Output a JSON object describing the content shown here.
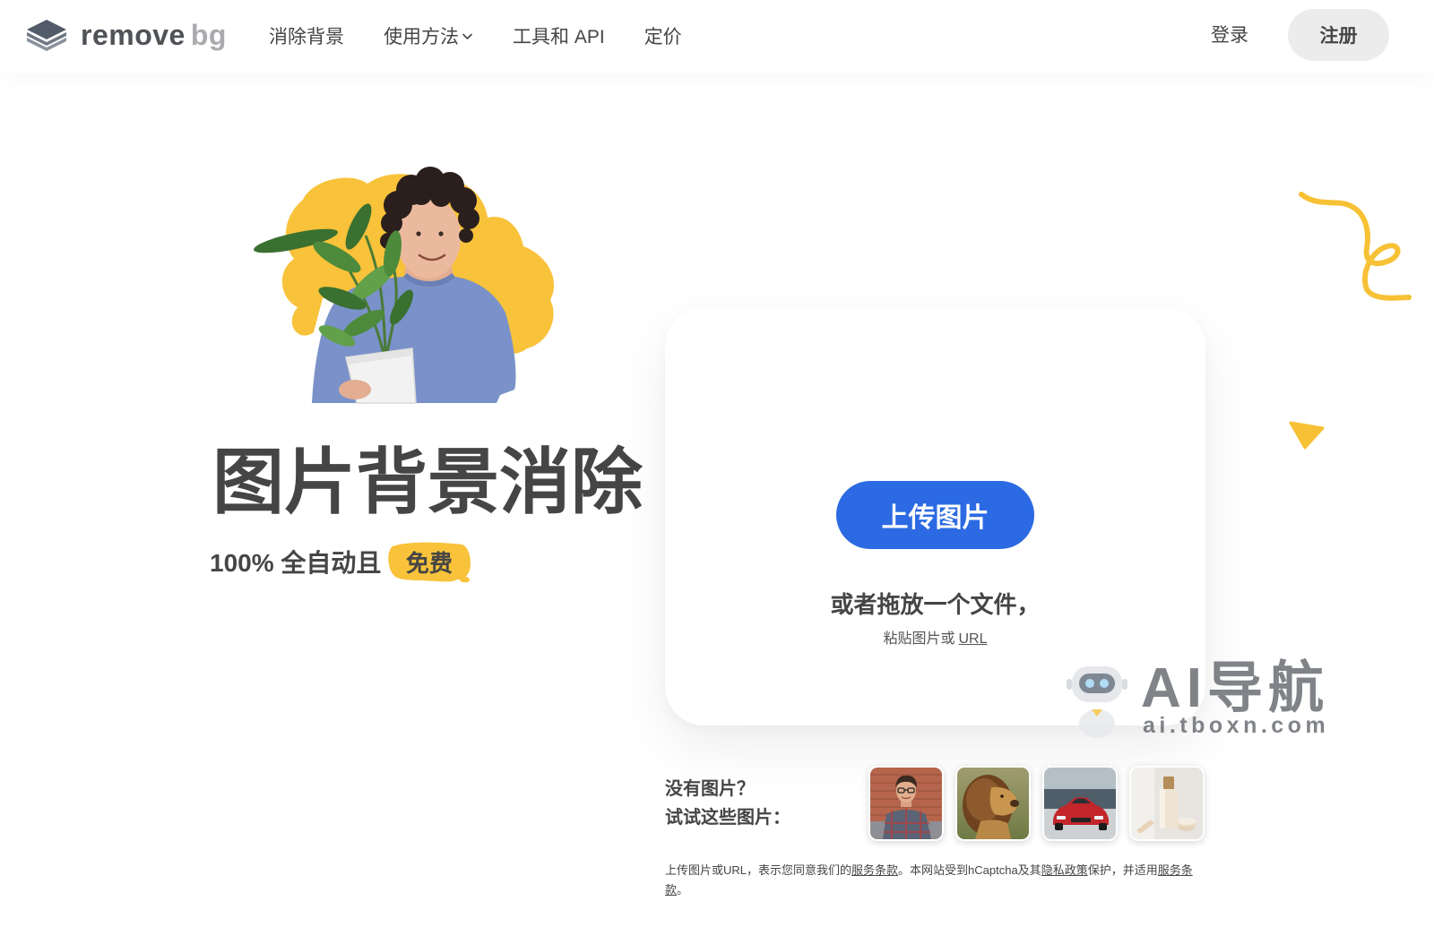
{
  "header": {
    "logo": {
      "word1": "remove",
      "word2": "bg"
    },
    "nav": [
      {
        "label": "消除背景"
      },
      {
        "label": "使用方法",
        "has_dropdown": true
      },
      {
        "label": "工具和 API"
      },
      {
        "label": "定价"
      }
    ],
    "login_label": "登录",
    "signup_label": "注册"
  },
  "hero": {
    "title": "图片背景消除",
    "subtitle_prefix": "100% 全自动且",
    "subtitle_highlight": "免费"
  },
  "upload": {
    "button_label": "上传图片",
    "drop_text": "或者拖放一个文件，",
    "paste_prefix": "粘贴图片或",
    "paste_link": "URL"
  },
  "samples": {
    "line1": "没有图片？",
    "line2": "试试这些图片："
  },
  "legal": {
    "text_1": "上传图片或URL，表示您同意我们的",
    "link_terms": "服务条款",
    "text_2": "。本网站受到hCaptcha及其",
    "link_privacy": "隐私政策",
    "text_3": "保护，并适用",
    "link_terms_2": "服务条款",
    "text_4": "。"
  },
  "watermark": {
    "title": "AI导航",
    "url": "ai.tboxn.com"
  },
  "icons": {
    "logo": "removebg-logo-icon",
    "nav_dropdown": "chevron-down-icon",
    "watermark": "robot-icon"
  },
  "colors": {
    "primary_blue": "#2b6ae2",
    "accent_yellow": "#f8c23a",
    "text": "#454545",
    "signup_bg": "#ececec"
  }
}
